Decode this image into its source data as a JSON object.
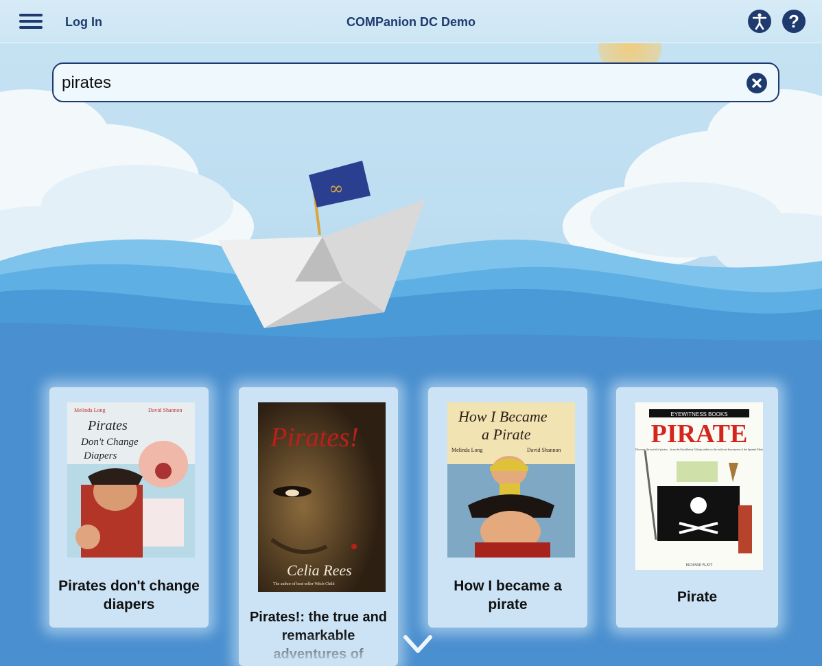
{
  "header": {
    "login_label": "Log In",
    "title": "COMPanion DC Demo"
  },
  "search": {
    "query": "pirates",
    "placeholder": ""
  },
  "results": [
    {
      "title": "Pirates don't change diapers",
      "cover_title": "Pirates Don't Change Diapers",
      "author": "Melinda Long",
      "illustrator": "David Shannon"
    },
    {
      "title": "Pirates!: the true and remarkable adventures of",
      "cover_title": "Pirates!",
      "author": "Celia Rees",
      "cover_tagline": "The author of best-seller Witch Child"
    },
    {
      "title": "How I became a pirate",
      "cover_title": "How I Became a Pirate",
      "author": "Melinda Long",
      "illustrator": "David Shannon"
    },
    {
      "title": "Pirate",
      "cover_series": "EYEWITNESS BOOKS",
      "cover_title": "PIRATE",
      "cover_blurb": "Discover the world of pirates – from the bloodthirsty Viking raiders to the cutthroat buccaneers of the Spanish Main",
      "author": "RICHARD PLATT"
    }
  ],
  "colors": {
    "navy": "#1e3a6e",
    "sky": "#cde6f4",
    "sea": "#4a8fcf",
    "card": "#d6eaf8"
  },
  "icons": {
    "menu": "hamburger-icon",
    "accessibility": "accessibility-icon",
    "help": "question-mark-icon",
    "clear": "close-circle-icon",
    "scroll": "chevron-down-icon"
  }
}
